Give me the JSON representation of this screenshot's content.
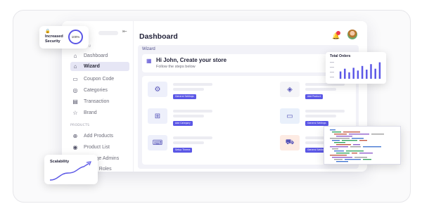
{
  "sidebar": {
    "collapse_icon": "collapse-left-icon",
    "sections": {
      "main_menu": "MAIN MENU",
      "products": "PRODUCTS"
    },
    "items": [
      {
        "label": "Dashboard",
        "icon": "home-icon",
        "glyph": "⌂",
        "active": false
      },
      {
        "label": "Wizard",
        "icon": "home-icon",
        "glyph": "⌂",
        "active": true
      },
      {
        "label": "Coupon Code",
        "icon": "coupon-icon",
        "glyph": "▭",
        "active": false
      },
      {
        "label": "Categories",
        "icon": "categories-icon",
        "glyph": "◎",
        "active": false
      },
      {
        "label": "Transaction",
        "icon": "document-icon",
        "glyph": "▤",
        "active": false
      },
      {
        "label": "Brand",
        "icon": "star-icon",
        "glyph": "☆",
        "active": false
      },
      {
        "label": "Add Products",
        "icon": "add-circle-icon",
        "glyph": "⊕",
        "active": false
      },
      {
        "label": "Product List",
        "icon": "box-icon",
        "glyph": "◉",
        "active": false
      },
      {
        "label": "Manage Admins",
        "icon": "user-circle-icon",
        "glyph": "◍",
        "active": false
      },
      {
        "label": "Admin Roles",
        "icon": "roles-icon",
        "glyph": "◍",
        "active": false
      }
    ]
  },
  "header": {
    "title": "Dashboard",
    "notification_icon": "bell-icon",
    "avatar": "user-avatar"
  },
  "wizard": {
    "label": "Wizard",
    "greeting": "Hi John, Create your store",
    "subtitle": "Follow the steps below",
    "greeting_icon": "store-icon"
  },
  "steps": [
    {
      "button": "General Settings",
      "icon": "settings-icon",
      "glyph": "⚙"
    },
    {
      "button": "Add Product",
      "icon": "tag-icon",
      "glyph": "◈"
    },
    {
      "button": "Add Category",
      "icon": "grid-icon",
      "glyph": "⊞"
    },
    {
      "button": "General Settings",
      "icon": "card-icon",
      "glyph": "▭"
    },
    {
      "button": "Setup Theme",
      "icon": "keyboard-icon",
      "glyph": "⌨"
    },
    {
      "button": "General Settings",
      "icon": "truck-icon",
      "glyph": "⛟"
    }
  ],
  "security_badge": {
    "lock_icon": "lock-icon",
    "line1": "Increased",
    "line2": "Security",
    "progress": "100%"
  },
  "total_orders": {
    "title": "Total Orders",
    "chart_data": {
      "type": "bar",
      "categories": [
        "",
        "",
        "",
        "",
        "",
        "",
        "",
        "",
        "",
        ""
      ],
      "values": [
        40,
        55,
        35,
        60,
        45,
        70,
        50,
        80,
        55,
        90
      ],
      "ylim": [
        0,
        100
      ]
    }
  },
  "scalability": {
    "title": "Scalability",
    "icon": "trend-up-icon"
  },
  "colors": {
    "accent": "#5b57e6",
    "active_bg": "#e6e6f5",
    "notification": "#f0394a"
  }
}
